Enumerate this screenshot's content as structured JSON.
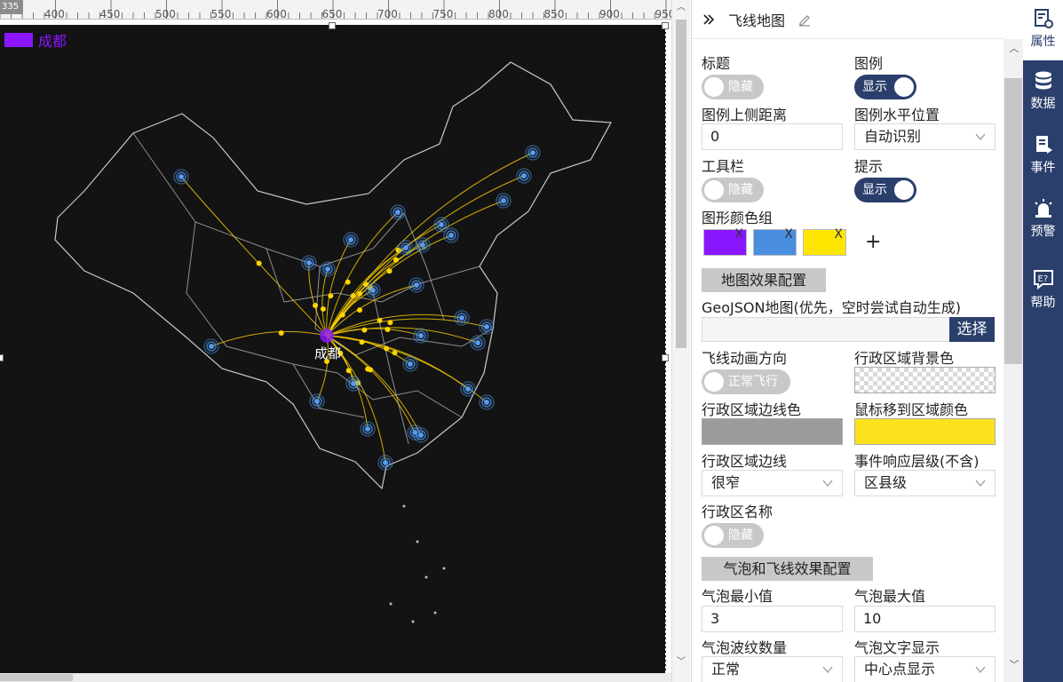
{
  "ruler": {
    "corner": "335",
    "ticks": [
      "400",
      "450",
      "500",
      "550",
      "600",
      "650",
      "700",
      "750",
      "800",
      "850",
      "900",
      "950"
    ]
  },
  "map": {
    "legend_label": "成都",
    "legend_color": "#8a16ff",
    "center_label": "成都",
    "line_color": "#ffd500"
  },
  "panel": {
    "title": "飞线地图",
    "title_label": "标题",
    "title_toggle": "隐藏",
    "legend_label": "图例",
    "legend_toggle": "显示",
    "legend_top_label": "图例上侧距离",
    "legend_top_value": "0",
    "legend_h_label": "图例水平位置",
    "legend_h_value": "自动识别",
    "toolbar_label": "工具栏",
    "toolbar_toggle": "隐藏",
    "tip_label": "提示",
    "tip_toggle": "显示",
    "color_group_label": "图形颜色组",
    "color_group": [
      "#8a16ff",
      "#4a8ee0",
      "#ffe600"
    ],
    "add_symbol": "+",
    "remove_symbol": "X",
    "map_effect_btn": "地图效果配置",
    "geojson_label": "GeoJSON地图(优先，空时尝试自动生成)",
    "choose_btn": "选择",
    "fly_dir_label": "飞线动画方向",
    "fly_dir_toggle": "正常飞行",
    "area_bg_label": "行政区域背景色",
    "area_border_color_label": "行政区域边线色",
    "area_border_color": "#9b9b9b",
    "hover_color_label": "鼠标移到区域颜色",
    "hover_color": "#fbe21c",
    "area_border_label": "行政区域边线",
    "area_border_value": "很窄",
    "event_level_label": "事件响应层级(不含)",
    "event_level_value": "区县级",
    "area_name_label": "行政区名称",
    "area_name_toggle": "隐藏",
    "bubble_btn": "气泡和飞线效果配置",
    "bubble_min_label": "气泡最小值",
    "bubble_min_value": "3",
    "bubble_max_label": "气泡最大值",
    "bubble_max_value": "10",
    "ripple_label": "气泡波纹数量",
    "ripple_value": "正常",
    "bubble_text_label": "气泡文字显示",
    "bubble_text_value": "中心点显示"
  },
  "tools": {
    "props": "属性",
    "data": "数据",
    "events": "事件",
    "alert": "预警",
    "help": "帮助"
  },
  "colors": {
    "brand": "#2b3f6c",
    "map_bg": "#131313"
  }
}
